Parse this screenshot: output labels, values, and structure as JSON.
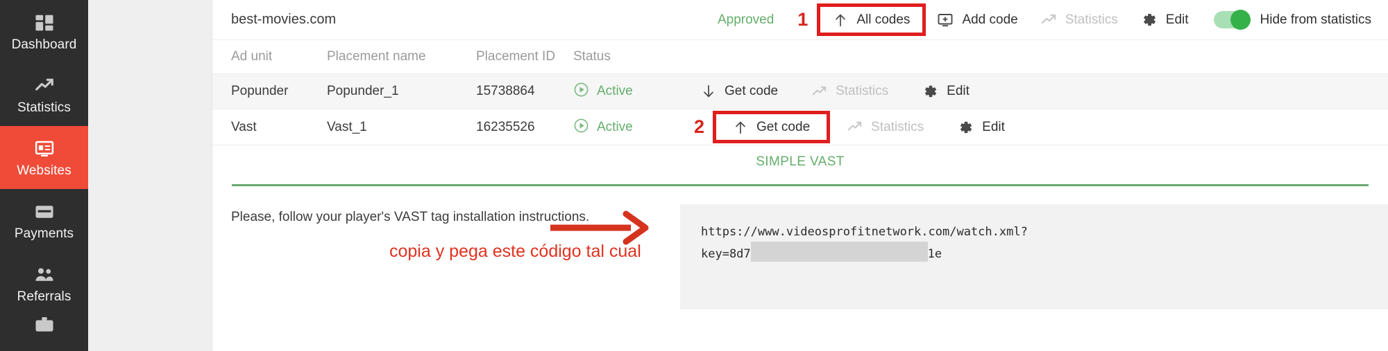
{
  "sidebar": {
    "items": [
      {
        "label": "Dashboard",
        "icon": "dashboard-icon",
        "active": false
      },
      {
        "label": "Statistics",
        "icon": "trend-up-icon",
        "active": false
      },
      {
        "label": "Websites",
        "icon": "websites-icon",
        "active": true
      },
      {
        "label": "Payments",
        "icon": "credit-card-icon",
        "active": false
      },
      {
        "label": "Referrals",
        "icon": "people-icon",
        "active": false
      },
      {
        "label": "",
        "icon": "briefcase-icon",
        "active": false
      }
    ],
    "active_color": "#ef4b38",
    "background": "#2e2e2e"
  },
  "header": {
    "site_name": "best-movies.com",
    "status": "Approved",
    "status_color": "#63ae6b",
    "step_marker": "1",
    "all_codes_label": "All codes",
    "add_code_label": "Add code",
    "statistics_label": "Statistics",
    "edit_label": "Edit",
    "toggle_label": "Hide from statistics",
    "toggle_on": true,
    "highlight_color": "#e01e1e"
  },
  "table": {
    "columns": [
      "Ad unit",
      "Placement name",
      "Placement ID",
      "Status"
    ],
    "rows": [
      {
        "ad_unit": "Popunder",
        "placement_name": "Popunder_1",
        "placement_id": "15738864",
        "status": "Active",
        "get_code_label": "Get code",
        "get_code_arrow": "arrow-down-icon",
        "statistics_label": "Statistics",
        "edit_label": "Edit",
        "step_marker": "",
        "highlighted": false
      },
      {
        "ad_unit": "Vast",
        "placement_name": "Vast_1",
        "placement_id": "16235526",
        "status": "Active",
        "get_code_label": "Get code",
        "get_code_arrow": "arrow-up-icon",
        "statistics_label": "Statistics",
        "edit_label": "Edit",
        "step_marker": "2",
        "highlighted": true
      }
    ]
  },
  "code_section": {
    "title": "SIMPLE VAST",
    "title_color": "#63ae6b",
    "instruction": "Please, follow your player's VAST tag installation instructions.",
    "annotation": "copia y pega este código tal cual",
    "annotation_color": "#e0321f",
    "code_line_1": "https://www.videosprofitnetwork.com/watch.xml?",
    "code_key_prefix": "key=8d7",
    "code_key_suffix": "1e"
  }
}
